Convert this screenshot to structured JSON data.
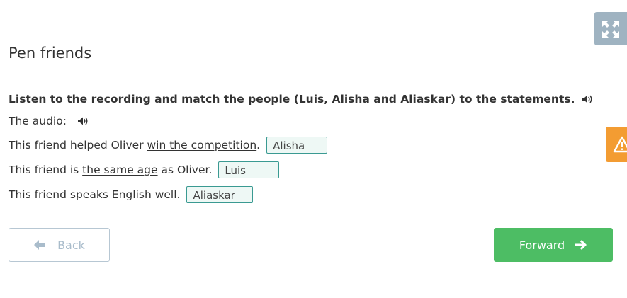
{
  "page": {
    "title": "Pen friends",
    "instruction": "Listen to the recording and match the people (Luis, Alisha and Aliaskar) to the statements.",
    "audio_label": "The audio:"
  },
  "statements": [
    {
      "before": "This friend helped Oliver ",
      "underlined": "win the competition",
      "after": ".",
      "answer": "Alisha"
    },
    {
      "before": "This friend is ",
      "underlined": "the same age",
      "after": " as Oliver.",
      "answer": "Luis"
    },
    {
      "before": "This friend ",
      "underlined": "speaks English well",
      "after": ".",
      "answer": "Aliaskar"
    }
  ],
  "nav": {
    "back_label": "Back",
    "forward_label": "Forward"
  },
  "icons": {
    "expand": "expand-arrows-icon",
    "warning": "warning-triangle-icon",
    "speaker": "speaker-icon",
    "back": "arrow-left-icon",
    "forward": "arrow-right-icon"
  },
  "colors": {
    "forward_button": "#4dbd64",
    "expand_button": "#9fb3c1",
    "warning_button": "#f39c32",
    "answer_border": "#3a9a92",
    "answer_background": "#eef8f5"
  }
}
